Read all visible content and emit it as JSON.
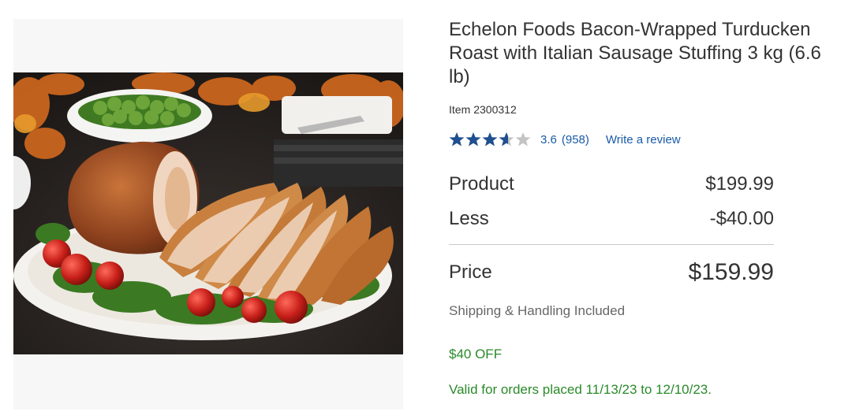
{
  "product": {
    "title": "Echelon Foods Bacon-Wrapped Turducken Roast with Italian Sausage Stuffing 3 kg (6.6 lb)",
    "item_label": "Item",
    "item_number": "2300312",
    "image_alt": "Bacon-wrapped turducken roast sliced on a platter with parsley and cherry tomatoes"
  },
  "rating": {
    "value": "3.6",
    "count": "(958)",
    "stars_filled": 3.6,
    "stars_total": 5,
    "write_review": "Write a review"
  },
  "pricing": {
    "product_label": "Product",
    "product_amount": "$199.99",
    "less_label": "Less",
    "less_amount": "-$40.00",
    "price_label": "Price",
    "price_amount": "$159.99"
  },
  "shipping": "Shipping & Handling Included",
  "promo": {
    "text": "$40 OFF",
    "validity": "Valid for orders placed 11/13/23 to 12/10/23."
  },
  "colors": {
    "link": "#1a5aa8",
    "star_filled": "#1f4f8f",
    "star_empty": "#c4c4c4",
    "promo": "#2a8a2a"
  }
}
